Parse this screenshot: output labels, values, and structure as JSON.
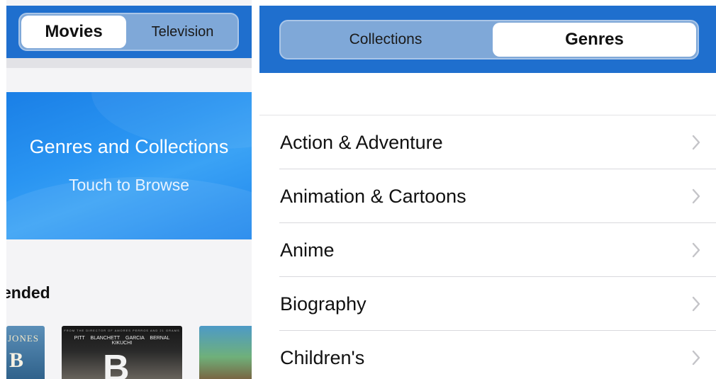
{
  "left_screen": {
    "segmented": {
      "active": "Movies",
      "inactive": "Television"
    },
    "banner": {
      "title": "Genres and Collections",
      "subtitle": "Touch to Browse"
    },
    "section_title": "ended",
    "posters": [
      {
        "text_top": "JONES",
        "text_big": "B"
      },
      {
        "credit_line": "FROM THE DIRECTOR OF AMORES PERROS AND 21 GRAMS",
        "names": "PITT BLANCHETT GARCIA BERNAL KIKUCHI",
        "letter": "B"
      },
      {}
    ]
  },
  "right_screen": {
    "segmented": {
      "inactive": "Collections",
      "active": "Genres"
    },
    "genres": [
      {
        "label": "Action & Adventure"
      },
      {
        "label": "Animation & Cartoons"
      },
      {
        "label": "Anime"
      },
      {
        "label": "Biography"
      },
      {
        "label": "Children's"
      }
    ]
  },
  "colors": {
    "header_blue": "#1f6fce",
    "segment_bg": "#7fa8d8",
    "banner_blue": "#2a95f2",
    "chevron_gray": "#c4c4c8"
  },
  "icons": {
    "row_chevron": "chevron-right-icon"
  }
}
